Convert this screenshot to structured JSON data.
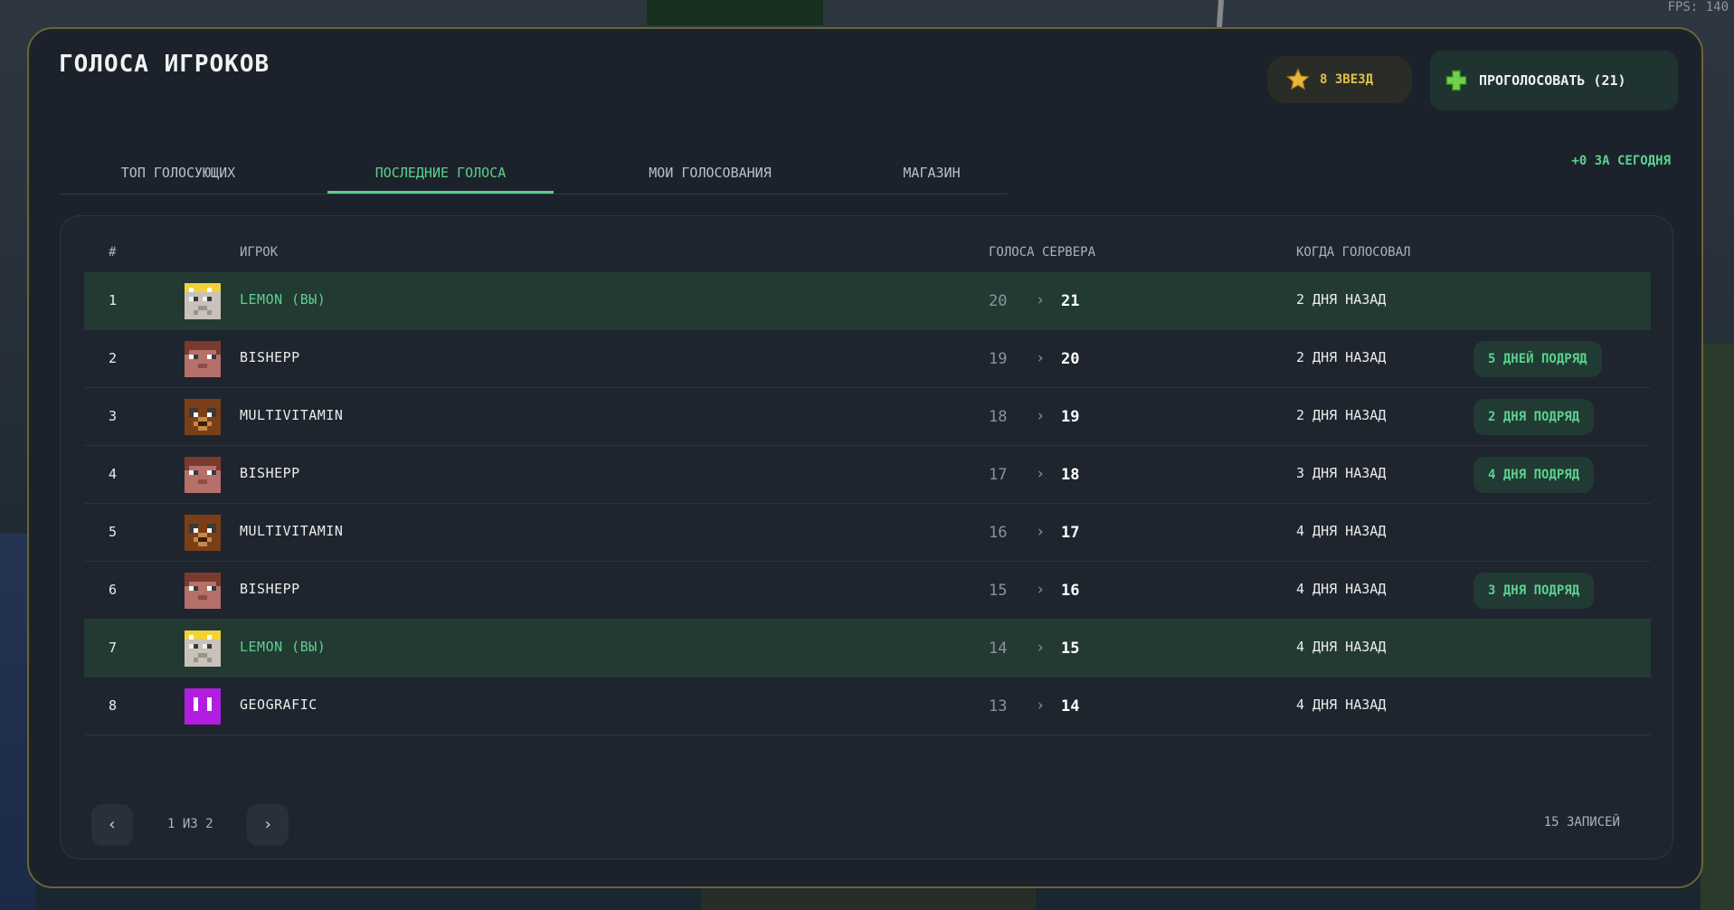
{
  "fps": "FPS: 140",
  "title": "ГОЛОСА ИГРОКОВ",
  "stars": {
    "label": "8 ЗВЕЗД",
    "icon": "star-icon",
    "color": "#e0c14a"
  },
  "vote_button": {
    "label": "ПРОГОЛОСОВАТЬ (21)",
    "icon": "plus-icon",
    "color": "#6fd04a"
  },
  "today": "+0 ЗА СЕГОДНЯ",
  "tabs": [
    {
      "label": "ТОП ГОЛОСУЮЩИХ"
    },
    {
      "label": "ПОСЛЕДНИЕ ГОЛОСА",
      "active": true
    },
    {
      "label": "МОИ ГОЛОСОВАНИЯ"
    },
    {
      "label": "МАГАЗИН"
    }
  ],
  "table": {
    "headers": {
      "num": "#",
      "player": "ИГРОК",
      "server_votes": "ГОЛОСА СЕРВЕРА",
      "when": "КОГДА ГОЛОСОВАЛ"
    },
    "rows": [
      {
        "num": "1",
        "name": "LEMON (ВЫ)",
        "me": true,
        "skin": "lemon",
        "from": "20",
        "to": "21",
        "when": "2 ДНЯ НАЗАД",
        "streak": ""
      },
      {
        "num": "2",
        "name": "BISHEPP",
        "me": false,
        "skin": "bishepp",
        "from": "19",
        "to": "20",
        "when": "2 ДНЯ НАЗАД",
        "streak": "5 ДНЕЙ ПОДРЯД"
      },
      {
        "num": "3",
        "name": "MULTIVITAMIN",
        "me": false,
        "skin": "multivitamin",
        "from": "18",
        "to": "19",
        "when": "2 ДНЯ НАЗАД",
        "streak": "2 ДНЯ ПОДРЯД"
      },
      {
        "num": "4",
        "name": "BISHEPP",
        "me": false,
        "skin": "bishepp",
        "from": "17",
        "to": "18",
        "when": "3 ДНЯ НАЗАД",
        "streak": "4 ДНЯ ПОДРЯД"
      },
      {
        "num": "5",
        "name": "MULTIVITAMIN",
        "me": false,
        "skin": "multivitamin",
        "from": "16",
        "to": "17",
        "when": "4 ДНЯ НАЗАД",
        "streak": ""
      },
      {
        "num": "6",
        "name": "BISHEPP",
        "me": false,
        "skin": "bishepp",
        "from": "15",
        "to": "16",
        "when": "4 ДНЯ НАЗАД",
        "streak": "3 ДНЯ ПОДРЯД"
      },
      {
        "num": "7",
        "name": "LEMON (ВЫ)",
        "me": true,
        "skin": "lemon",
        "from": "14",
        "to": "15",
        "when": "4 ДНЯ НАЗАД",
        "streak": ""
      },
      {
        "num": "8",
        "name": "GEOGRAFIC",
        "me": false,
        "skin": "geografic",
        "from": "13",
        "to": "14",
        "when": "4 ДНЯ НАЗАД",
        "streak": ""
      }
    ]
  },
  "pager": {
    "info": "1 ИЗ 2",
    "prev": "‹",
    "next": "›",
    "records": "15 ЗАПИСЕЙ"
  }
}
